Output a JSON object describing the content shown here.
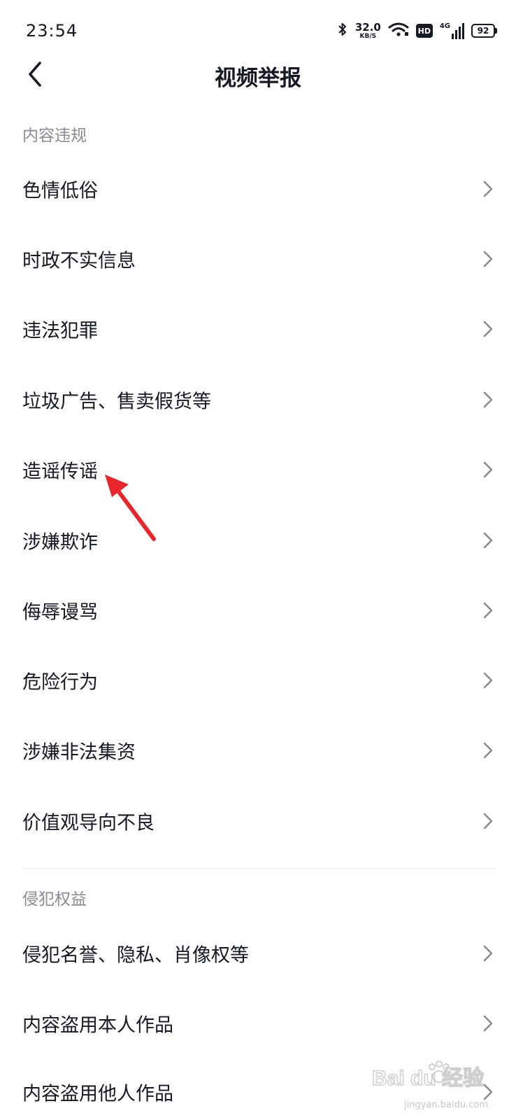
{
  "status_bar": {
    "time": "23:54",
    "net_speed": "32.0",
    "net_speed_unit": "KB/S",
    "hd_label": "HD",
    "network_type": "4G",
    "battery": "92"
  },
  "header": {
    "title": "视频举报"
  },
  "sections": [
    {
      "title": "内容违规",
      "items": [
        "色情低俗",
        "时政不实信息",
        "违法犯罪",
        "垃圾广告、售卖假货等",
        "造谣传谣",
        "涉嫌欺诈",
        "侮辱谩骂",
        "危险行为",
        "涉嫌非法集资",
        "价值观导向不良"
      ]
    },
    {
      "title": "侵犯权益",
      "items": [
        "侵犯名誉、隐私、肖像权等",
        "内容盗用本人作品",
        "内容盗用他人作品"
      ]
    }
  ],
  "watermark": {
    "logo_text": "Bai du 经验",
    "url": "jingyan.baidu.com"
  },
  "colors": {
    "text_primary": "#161823",
    "text_secondary": "#8a8b91",
    "chevron": "#8a8b91",
    "annotation_arrow": "#e8262c"
  },
  "icons": {
    "back": "chevron-left-icon",
    "row": "chevron-right-icon"
  }
}
